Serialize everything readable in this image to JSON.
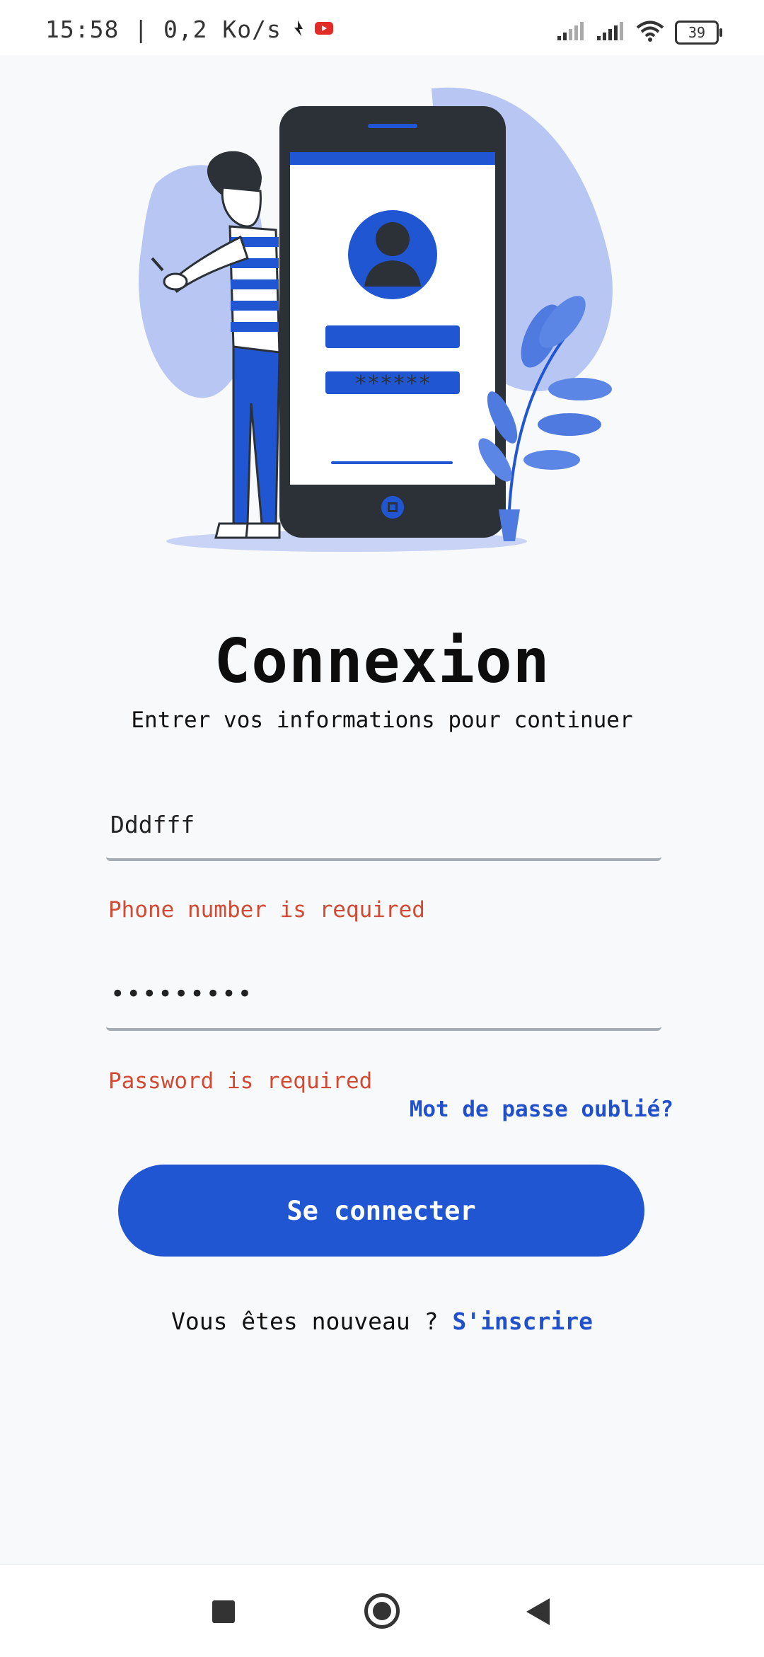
{
  "status_bar": {
    "time_speed": "15:58 | 0,2 Ko/s",
    "battery": "39",
    "icons": [
      "notification-icon",
      "youtube-icon",
      "signal-icon",
      "signal-icon",
      "wifi-icon",
      "battery-icon"
    ]
  },
  "header": {
    "title": "Connexion",
    "subtitle": "Entrer vos informations pour continuer"
  },
  "form": {
    "phone_value": "Dddfff",
    "phone_error": "Phone number is required",
    "password_value": "•••••••••",
    "password_error": "Password is required",
    "forgot_label": "Mot de passe oublié?",
    "submit_label": "Se connecter"
  },
  "signup": {
    "prompt": "Vous êtes nouveau ? ",
    "link_label": "S'inscrire"
  },
  "illustration": {
    "password_mask": "******"
  },
  "colors": {
    "accent": "#2156d3",
    "error": "#d24a33",
    "background": "#f8f9fb"
  }
}
